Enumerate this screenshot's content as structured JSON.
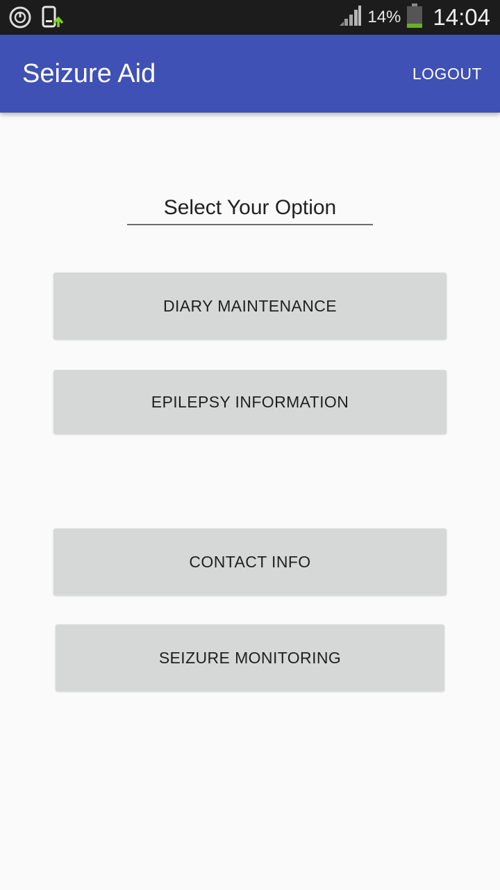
{
  "status_bar": {
    "left_icons": [
      "power-circle-icon",
      "phone-upload-icon"
    ],
    "signal_icon": "signal-bars-icon",
    "battery_percent": "14%",
    "battery_icon": "battery-icon",
    "time": "14:04"
  },
  "app_bar": {
    "title": "Seizure Aid",
    "logout_label": "LOGOUT",
    "color": "#3f51b5"
  },
  "main": {
    "heading": "Select Your Option",
    "buttons": [
      {
        "label": "DIARY MAINTENANCE"
      },
      {
        "label": "EPILEPSY INFORMATION"
      },
      {
        "label": "CONTACT INFO"
      },
      {
        "label": "SEIZURE MONITORING"
      }
    ]
  },
  "colors": {
    "background": "#fafafa",
    "button": "#d6d7d7",
    "status_bar": "#1c1c1c",
    "battery_level": "#6ab023",
    "upload_arrow": "#7ed321"
  }
}
